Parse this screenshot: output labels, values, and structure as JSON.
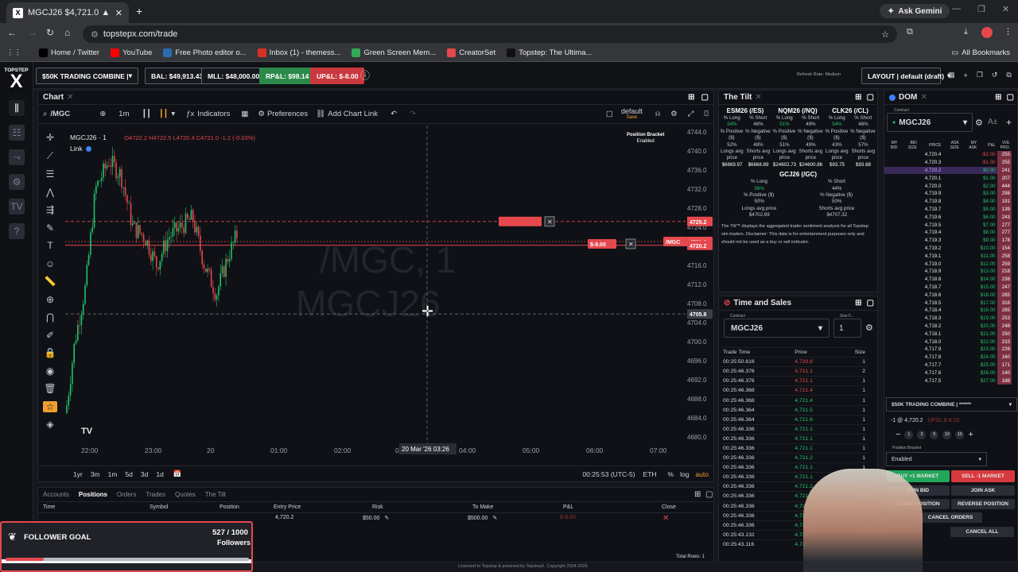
{
  "browser": {
    "tab_title": "MGCJ26 $4,721.0 ▲ +2.50%",
    "tab_favicon": "X",
    "url": "topstepx.com/trade",
    "ask_gemini": "Ask Gemini",
    "bookmarks": [
      {
        "label": "Home / Twitter",
        "color": "#000000"
      },
      {
        "label": "YouTube",
        "color": "#ff0000"
      },
      {
        "label": "Free Photo editor o...",
        "color": "#2b6cb0"
      },
      {
        "label": "Inbox (1) - themess...",
        "color": "#d93025"
      },
      {
        "label": "Green Screen Mem...",
        "color": "#34a853"
      },
      {
        "label": "CreatorSet",
        "color": "#e5484d"
      },
      {
        "label": "Topstep: The Ultima...",
        "color": "#111111"
      }
    ],
    "all_bookmarks": "All Bookmarks"
  },
  "header": {
    "logo_text": "TOPSTEP",
    "logo_x": "X",
    "account": "$50K TRADING COMBINE | *...",
    "bal": "BAL: $49,913.43",
    "mll": "MLL: $48,000.00",
    "rpl": "RP&L: $98.14",
    "upl": "UP&L: $-8.00",
    "refresh": "Refresh Rate: Medium",
    "layout": "LAYOUT | default (draft)"
  },
  "chart": {
    "panel_title": "Chart",
    "symbol_search": "/MGC",
    "interval": "1m",
    "indicators": "Indicators",
    "preferences": "Preferences",
    "add_chart_link": "Add Chart Link",
    "default_label": "default",
    "save_label": "Save",
    "position_bracket": "Position Bracket",
    "position_bracket_status": "Enabled",
    "legend_symbol": "MGCJ26 · 1",
    "ohlc": "O4722.2 H4722.5 L4720.4 C4721.0 -1.2 (-0.03%)",
    "link": "Link",
    "watermark1": "/MGC, 1",
    "watermark2": "MGCJ26",
    "y_ticks": [
      "4744.0",
      "4740.0",
      "4736.0",
      "4732.0",
      "4728.0",
      "4724.0",
      "4720.0",
      "4716.0",
      "4712.0",
      "4708.0",
      "4704.0",
      "4700.0",
      "4696.0",
      "4692.0",
      "4688.0",
      "4684.0",
      "4680.0"
    ],
    "price_tags": [
      {
        "text": "4725.2",
        "color": "#e5484d"
      },
      {
        "text": "4721.0",
        "color": "#e5484d"
      },
      {
        "text": "4720.2",
        "color": "#e5484d"
      },
      {
        "text": "4705.8",
        "color": "#3a3f48"
      }
    ],
    "symbol_tag": "/MGC",
    "order_tag": "$-8.00",
    "x_ticks": [
      "22:00",
      "23:00",
      "20",
      "01:00",
      "02:00",
      "03",
      "04:00",
      "05:00",
      "06:00",
      "07:00"
    ],
    "crosshair_date": "20 Mar '26   03:26",
    "timeframes": [
      "1yr",
      "3m",
      "1m",
      "5d",
      "3d",
      "1d"
    ],
    "clock": "00:25:53 (UTC-5)",
    "session": "ETH",
    "pct": "%",
    "log": "log",
    "auto": "auto"
  },
  "positions": {
    "tabs": [
      "Accounts",
      "Positions",
      "Orders",
      "Trades",
      "Quotes",
      "The Tilt"
    ],
    "active_tab": "Positions",
    "headers": [
      "Time",
      "Symbol",
      "Position",
      "Entry Price",
      "Risk",
      "To Make",
      "P&L",
      "Close"
    ],
    "row": {
      "entry": "4,720.2",
      "risk": "$50.00",
      "to_make": "$500.00",
      "pnl": "$-8.00"
    },
    "total_rows": "Total Rows: 1",
    "license": "Licensed to Topstep & powered by TopstepX. Copyright 2024-2026"
  },
  "follower": {
    "label": "FOLLOWER GOAL",
    "count": "527 / 1000",
    "sub": "Followers",
    "progress": 0.527
  },
  "tilt": {
    "title": "The Tilt",
    "contracts": [
      {
        "name": "ESM26 (/ES)",
        "long_pct": "54%",
        "short_pct": "46%",
        "pos_pct": "52%",
        "neg_pct": "48%",
        "long_avg": "$6669.97",
        "short_avg": "$6668.89"
      },
      {
        "name": "NQM26 (/NQ)",
        "long_pct": "51%",
        "short_pct": "49%",
        "pos_pct": "51%",
        "neg_pct": "49%",
        "long_avg": "$24602.73",
        "short_avg": "$24600.86"
      },
      {
        "name": "CLK26 (/CL)",
        "long_pct": "54%",
        "short_pct": "46%",
        "pos_pct": "43%",
        "neg_pct": "57%",
        "long_avg": "$93.75",
        "short_avg": "$93.68"
      }
    ],
    "gc": {
      "name": "GCJ26 (/GC)",
      "long_pct": "56%",
      "short_pct": "44%",
      "pos_pct": "50%",
      "neg_pct": "50%",
      "long_avg": "$4702.69",
      "short_avg": "$4707.32"
    },
    "labels": {
      "long": "% Long",
      "short": "% Short",
      "pos": "% Positive ($)",
      "neg": "% Negative ($)",
      "long_avg": "Longs avg price",
      "short_avg": "Shorts avg price"
    },
    "disclaimer": "The Tilt™ displays the aggregated trader sentiment analysis for all Topstep sim traders. Disclaimer: This data is for entertainment purposes only and should not be used as a buy or sell indicator."
  },
  "ts": {
    "title": "Time and Sales",
    "contract_label": "Contract",
    "contract": "MGCJ26",
    "size_label": "Size F...",
    "size": "1",
    "headers": [
      "Trade Time",
      "Price",
      "Size"
    ],
    "rows": [
      [
        "00:25:50.616",
        "4,720.8",
        "1",
        "r"
      ],
      [
        "00:25:46.376",
        "4,721.1",
        "2",
        "r"
      ],
      [
        "00:25:46.376",
        "4,721.1",
        "1",
        "r"
      ],
      [
        "00:25:46.368",
        "4,721.4",
        "1",
        "r"
      ],
      [
        "00:25:46.368",
        "4,721.4",
        "1",
        "g"
      ],
      [
        "00:25:46.364",
        "4,721.5",
        "1",
        "g"
      ],
      [
        "00:25:46.364",
        "4,721.6",
        "1",
        "g"
      ],
      [
        "00:25:46.336",
        "4,721.1",
        "1",
        "g"
      ],
      [
        "00:25:46.336",
        "4,721.1",
        "1",
        "g"
      ],
      [
        "00:25:46.336",
        "4,721.1",
        "1",
        "g"
      ],
      [
        "00:25:46.336",
        "4,721.2",
        "1",
        "g"
      ],
      [
        "00:25:46.336",
        "4,721.1",
        "1",
        "g"
      ],
      [
        "00:25:46.336",
        "4,721.1",
        "1",
        "g"
      ],
      [
        "00:25:46.336",
        "4,721.2",
        "1",
        "g"
      ],
      [
        "00:25:46.336",
        "4,721.2",
        "1",
        "g"
      ],
      [
        "00:25:46.336",
        "4,721.2",
        "1",
        "g"
      ],
      [
        "00:25:46.336",
        "4,721.2",
        "1",
        "g"
      ],
      [
        "00:25:46.336",
        "4,721.2",
        "1",
        "g"
      ],
      [
        "00:25:43.132",
        "4,721.1",
        "1",
        "g"
      ],
      [
        "00:25:43.116",
        "4,721.1",
        "1",
        "g"
      ]
    ]
  },
  "dom": {
    "title": "DOM",
    "contract_label": "Contract",
    "contract": "MGCJ26",
    "headers": [
      "MY BID",
      "BID SIZE",
      "PRICE",
      "ASK SIZE",
      "MY ASK",
      "P&L",
      "VOL PRO."
    ],
    "rows": [
      [
        "4,720.4",
        "-$2.00",
        "255"
      ],
      [
        "4,720.3",
        "-$1.00",
        "255"
      ],
      [
        "4,720.2",
        "$0.00",
        "241"
      ],
      [
        "4,720.1",
        "$1.00",
        "207"
      ],
      [
        "4,720.0",
        "$2.00",
        "444"
      ],
      [
        "4,719.9",
        "$3.00",
        "298"
      ],
      [
        "4,719.8",
        "$4.00",
        "191"
      ],
      [
        "4,719.7",
        "$5.00",
        "139"
      ],
      [
        "4,719.6",
        "$6.00",
        "243"
      ],
      [
        "4,719.5",
        "$7.00",
        "277"
      ],
      [
        "4,719.4",
        "$8.00",
        "277"
      ],
      [
        "4,719.3",
        "$9.00",
        "178"
      ],
      [
        "4,719.2",
        "$10.00",
        "154"
      ],
      [
        "4,719.1",
        "$11.00",
        "258"
      ],
      [
        "4,719.0",
        "$12.00",
        "259"
      ],
      [
        "4,718.9",
        "$13.00",
        "218"
      ],
      [
        "4,718.8",
        "$14.00",
        "238"
      ],
      [
        "4,718.7",
        "$15.00",
        "247"
      ],
      [
        "4,718.6",
        "$16.00",
        "285"
      ],
      [
        "4,718.5",
        "$17.00",
        "316"
      ],
      [
        "4,718.4",
        "$18.00",
        "285"
      ],
      [
        "4,718.3",
        "$19.00",
        "253"
      ],
      [
        "4,718.2",
        "$20.00",
        "248"
      ],
      [
        "4,718.1",
        "$21.00",
        "250"
      ],
      [
        "4,718.0",
        "$22.00",
        "233"
      ],
      [
        "4,717.9",
        "$23.00",
        "226"
      ],
      [
        "4,717.8",
        "$24.00",
        "160"
      ],
      [
        "4,717.7",
        "$25.00",
        "171"
      ],
      [
        "4,717.6",
        "$26.00",
        "140"
      ],
      [
        "4,717.5",
        "$27.00",
        "188"
      ]
    ],
    "account": "$50K TRADING COMBINE | ******",
    "position": "-1 @ 4,720.2",
    "upl": "UPSL $-8.00",
    "pb_label": "Position Bracket",
    "pb_value": "Enabled",
    "qty": [
      "1",
      "3",
      "5",
      "10",
      "15"
    ],
    "buttons": {
      "buy": "BUY +1 MARKET",
      "sell": "SELL -1 MARKET",
      "join_bid": "JOIN BID",
      "join_ask": "JOIN ASK",
      "close": "CLOSE POSITION",
      "reverse": "REVERSE POSITION",
      "cancel_orders": "CANCEL ORDERS",
      "cancel_all": "CANCEL ALL"
    }
  },
  "colors": {
    "green": "#23c26b",
    "red": "#e5484d",
    "bg": "#0f1116"
  }
}
